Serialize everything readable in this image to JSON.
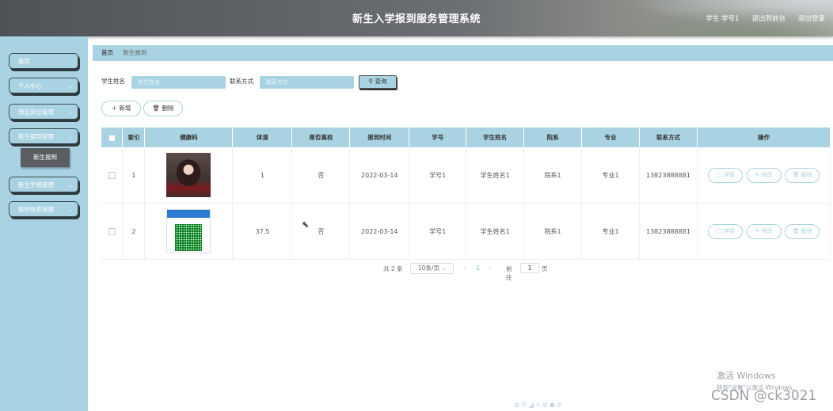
{
  "header": {
    "title": "新生入学报到服务管理系统",
    "user": "学生 学号1",
    "to_frontend": "退出到前台",
    "logout": "退出登录"
  },
  "sidebar": {
    "items": [
      {
        "label": "首页",
        "chevron": ""
      },
      {
        "label": "个人中心",
        "chevron": "⌄"
      },
      {
        "label": "预定床位管理",
        "chevron": "⌄"
      },
      {
        "label": "新生报到管理",
        "chevron": "⌄"
      },
      {
        "label": "新生学费管理",
        "chevron": "⌄"
      },
      {
        "label": "体检信息管理",
        "chevron": "⌄"
      }
    ],
    "submenu": "新生报到"
  },
  "breadcrumb": {
    "home": "首页",
    "current": "新生报到"
  },
  "search": {
    "name_label": "学生姓名",
    "name_placeholder": "学生姓名",
    "phone_label": "联系方式",
    "phone_placeholder": "联系方式",
    "button": "查询"
  },
  "actions": {
    "add": "新增",
    "delete": "删除"
  },
  "table": {
    "headers": [
      "索引",
      "健康码",
      "体温",
      "是否离校",
      "报到时间",
      "学号",
      "学生姓名",
      "院系",
      "专业",
      "联系方式",
      "操作"
    ],
    "rows": [
      {
        "index": "1",
        "health_code": "photo",
        "temperature": "1",
        "left_school": "否",
        "report_time": "2022-03-14",
        "student_id": "学号1",
        "name": "学生姓名1",
        "department": "院系1",
        "major": "专业1",
        "phone": "13823888881"
      },
      {
        "index": "2",
        "health_code": "qr-code",
        "temperature": "37.5",
        "left_school": "否",
        "report_time": "2022-03-14",
        "student_id": "学号1",
        "name": "学生姓名1",
        "department": "院系1",
        "major": "专业1",
        "phone": "13823888881"
      }
    ],
    "op_labels": {
      "detail": "详情",
      "edit": "修改",
      "delete": "删除"
    }
  },
  "pagination": {
    "total": "共 2 条",
    "page_size": "10条/页",
    "current_page": "1",
    "goto_label": "前往",
    "goto_value": "1",
    "page_suffix": "页"
  },
  "watermark": {
    "activate_title": "激活 Windows",
    "activate_sub": "转到\"设置\"以激活 Windows。",
    "csdn": "CSDN @ck3021"
  },
  "colors": {
    "accent": "#a9d3e2",
    "sidebar_active": "#5b5e61"
  }
}
